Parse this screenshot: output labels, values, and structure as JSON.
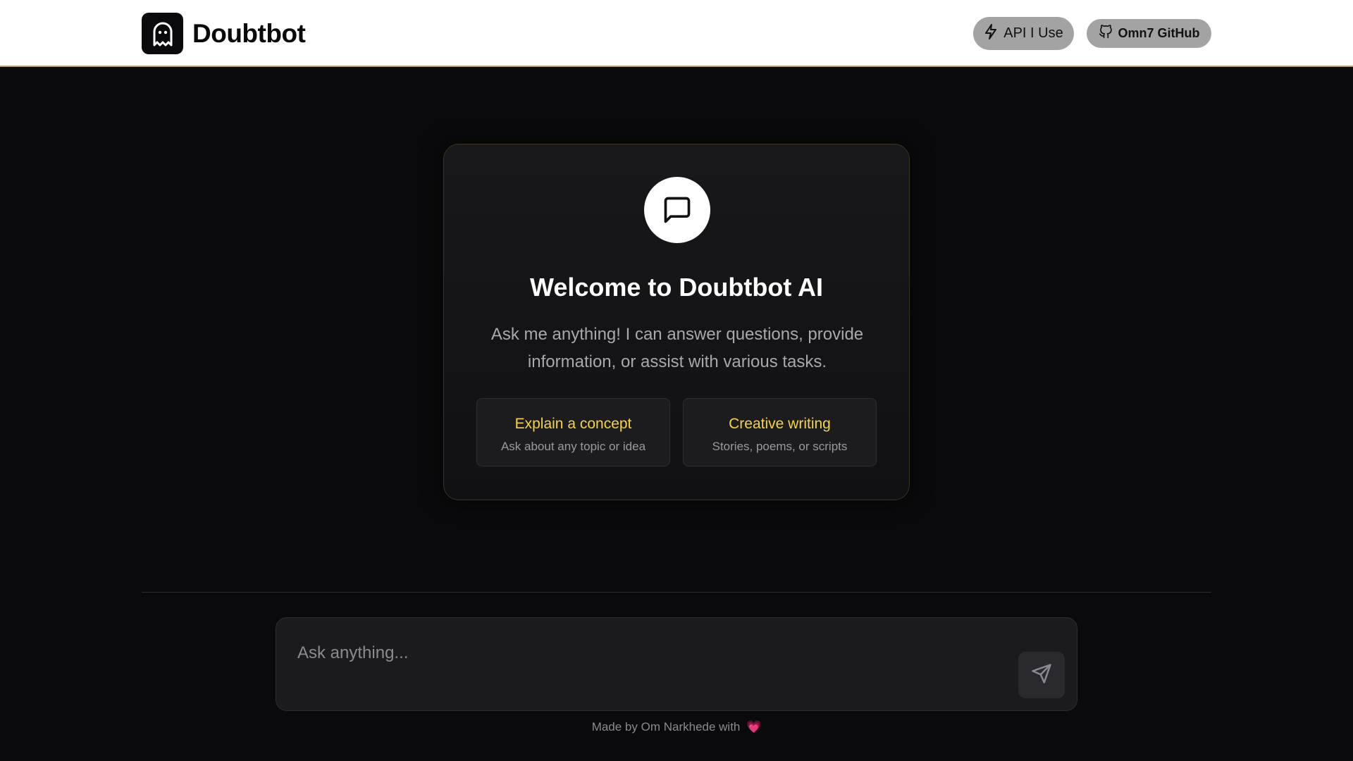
{
  "header": {
    "brand_name": "Doubtbot",
    "logo_icon": "ghost-icon",
    "api_button_label": "API I Use",
    "api_button_icon": "lightning-icon",
    "github_button_label": "Omn7 GitHub",
    "github_button_icon": "github-icon"
  },
  "welcome": {
    "icon": "chat-bubble-icon",
    "title": "Welcome to Doubtbot AI",
    "subtitle": "Ask me anything! I can answer questions, provide information, or assist with various tasks.",
    "suggestions": [
      {
        "title": "Explain a concept",
        "description": "Ask about any topic or idea"
      },
      {
        "title": "Creative writing",
        "description": "Stories, poems, or scripts"
      }
    ]
  },
  "composer": {
    "placeholder": "Ask anything...",
    "send_icon": "send-icon"
  },
  "footer": {
    "text": "Made by Om Narkhede with",
    "heart": "💗"
  },
  "colors": {
    "accent_yellow": "#f5d443",
    "background": "#0a0a0c",
    "card": "#18181b",
    "header_bg": "#ffffff",
    "nav_button_bg": "#a3a3a3"
  }
}
